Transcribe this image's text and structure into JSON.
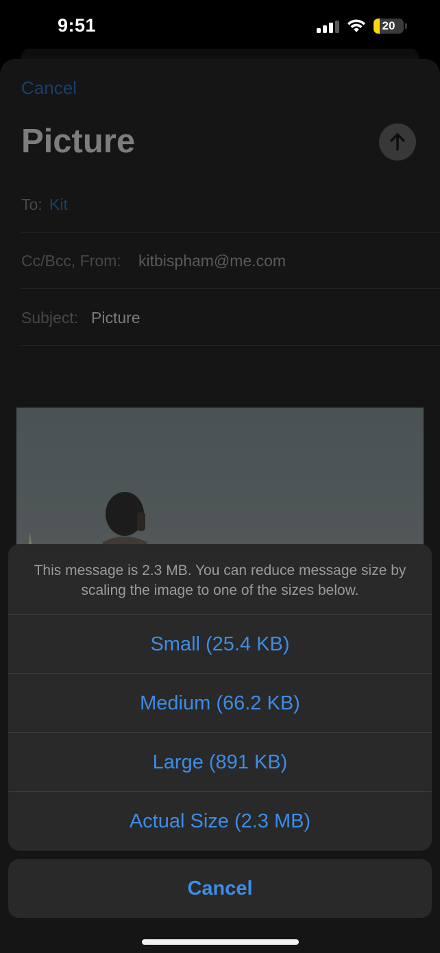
{
  "status_bar": {
    "time": "9:51",
    "battery_level": "20",
    "battery_fraction": 0.2,
    "battery_color": "#ffd60a",
    "icons": [
      "cellular-signal-icon",
      "wifi-icon",
      "battery-icon"
    ]
  },
  "compose": {
    "cancel_label": "Cancel",
    "title": "Picture",
    "send_icon": "arrow-up-icon",
    "to_label": "To:",
    "to_value": "Kit",
    "cc_label": "Cc/Bcc, From:",
    "from_value": "kitbispham@me.com",
    "subject_label": "Subject:",
    "subject_value": "Picture"
  },
  "action_sheet": {
    "message": "This message is 2.3 MB. You can reduce message size by scaling the image to one of the sizes below.",
    "options": [
      {
        "label": "Small (25.4 KB)"
      },
      {
        "label": "Medium (66.2 KB)"
      },
      {
        "label": "Large (891 KB)"
      },
      {
        "label": "Actual Size (2.3 MB)"
      }
    ],
    "cancel_label": "Cancel",
    "accent_color": "#3d8ce6"
  }
}
